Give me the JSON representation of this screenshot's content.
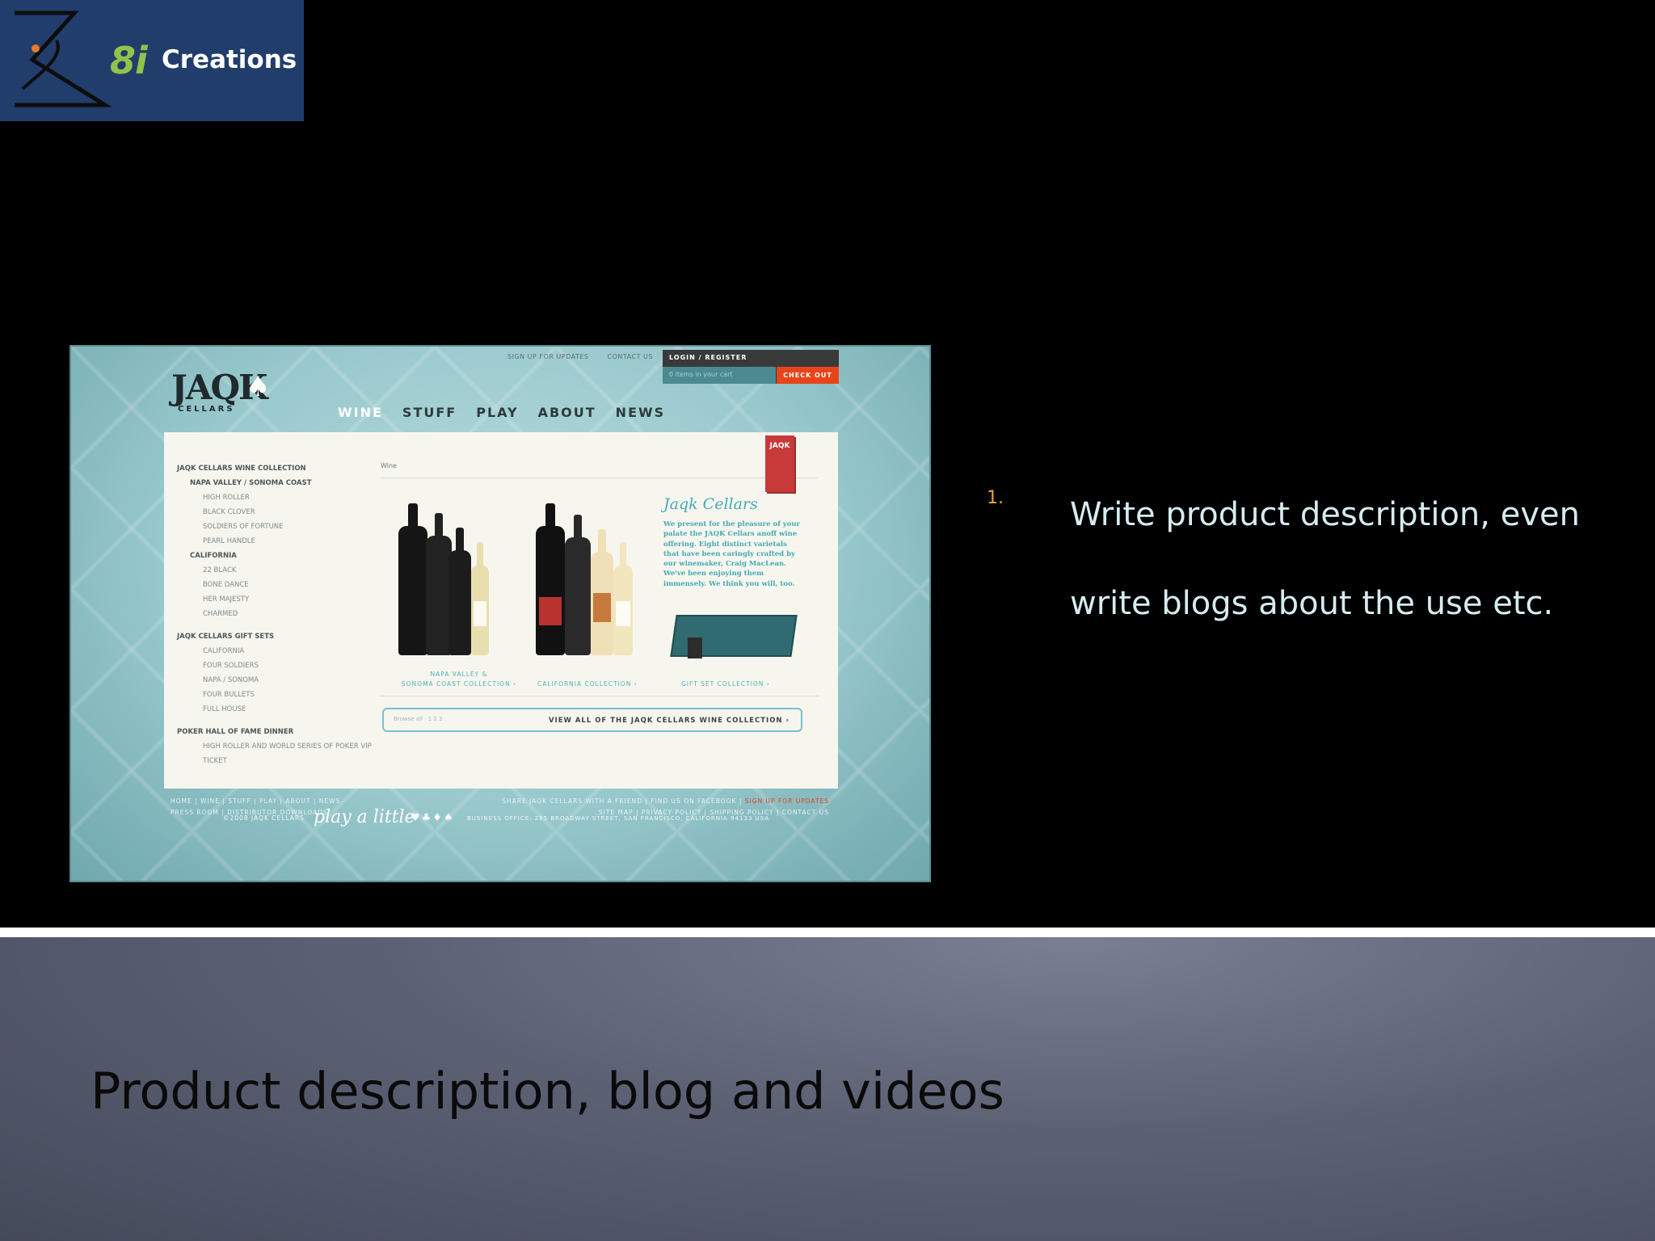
{
  "logo": {
    "mark": "8i",
    "word": "Creations"
  },
  "site": {
    "top_links": [
      "SIGN UP FOR UPDATES",
      "CONTACT US"
    ],
    "login_label": "LOGIN / REGISTER",
    "cart_text": "0 items in your cart",
    "checkout_label": "CHECK OUT",
    "brand_name": "JAQK",
    "brand_sub": "CELLARS",
    "nav": [
      "WINE",
      "STUFF",
      "PLAY",
      "ABOUT",
      "NEWS"
    ],
    "nav_active": "WINE",
    "breadcrumb": "Wine",
    "badge": "JAQK",
    "categories": [
      {
        "label": "JAQK CELLARS WINE COLLECTION",
        "level": "h1"
      },
      {
        "label": "NAPA VALLEY / SONOMA COAST",
        "level": "h2"
      },
      {
        "label": "HIGH ROLLER",
        "level": "l3"
      },
      {
        "label": "BLACK CLOVER",
        "level": "l3"
      },
      {
        "label": "SOLDIERS OF FORTUNE",
        "level": "l3"
      },
      {
        "label": "PEARL HANDLE",
        "level": "l3"
      },
      {
        "label": "CALIFORNIA",
        "level": "h2"
      },
      {
        "label": "22 BLACK",
        "level": "l3"
      },
      {
        "label": "BONE DANCE",
        "level": "l3"
      },
      {
        "label": "HER MAJESTY",
        "level": "l3"
      },
      {
        "label": "CHARMED",
        "level": "l3"
      },
      {
        "label": "JAQK CELLARS GIFT SETS",
        "level": "h1"
      },
      {
        "label": "CALIFORNIA",
        "level": "l3"
      },
      {
        "label": "FOUR SOLDIERS",
        "level": "l3"
      },
      {
        "label": "NAPA / SONOMA",
        "level": "l3"
      },
      {
        "label": "FOUR BULLETS",
        "level": "l3"
      },
      {
        "label": "FULL HOUSE",
        "level": "l3"
      },
      {
        "label": "POKER HALL OF FAME DINNER",
        "level": "h1"
      },
      {
        "label": "HIGH ROLLER AND WORLD SERIES OF POKER VIP",
        "level": "l3"
      },
      {
        "label": "TICKET",
        "level": "l3"
      }
    ],
    "collections": {
      "napa_line1": "NAPA VALLEY &",
      "napa_line2": "SONOMA COAST COLLECTION ›",
      "california": "CALIFORNIA COLLECTION ›",
      "gift": "GIFT SET COLLECTION ›"
    },
    "jaqk_title": "Jaqk Cellars",
    "jaqk_body": "We present for the pleasure of your palate the JAQK Cellars anoff wine offering. Eight distinct varietals that have been caringly crafted by our winemaker, Craig MacLean. We've been enjoying them immensely. We think you will, too.",
    "view_all": "VIEW ALL OF THE JAQK CELLARS WINE COLLECTION ›",
    "view_all_hint": "Browse all · 1 2 3",
    "footer_left_1": "HOME  |  WINE  |  STUFF  |  PLAY  |  ABOUT  |  NEWS",
    "footer_left_2": "PRESS ROOM  |  DISTRIBUTOR DOWNLOADS",
    "footer_right_1": "SHARE JAQK CELLARS WITH A FRIEND  |  FIND US ON FACEBOOK  |",
    "footer_right_signup": " SIGN UP FOR UPDATES",
    "footer_right_2": "SITE MAP  |  PRIVACY POLICY  |  SHIPPING POLICY  |  CONTACT US",
    "footer_copy": "©2008 JAQK CELLARS",
    "footer_tag": "play a little",
    "footer_suits": "♥♣♦♠",
    "footer_office": "BUSINESS OFFICE: 285 BROADWAY STREET, SAN FRANCISCO, CALIFORNIA 94133 USA"
  },
  "bullet": {
    "number": "1.",
    "text": "Write product description, even write blogs about the use etc."
  },
  "title": "Product description, blog and videos",
  "colors": {
    "accent_orange": "#e8a33b",
    "bullet_text": "#d6ecef",
    "logo_bg": "#213d6b",
    "logo_green": "#8fc34a",
    "site_teal": "#98c8cc",
    "checkout_red": "#e8441a"
  }
}
